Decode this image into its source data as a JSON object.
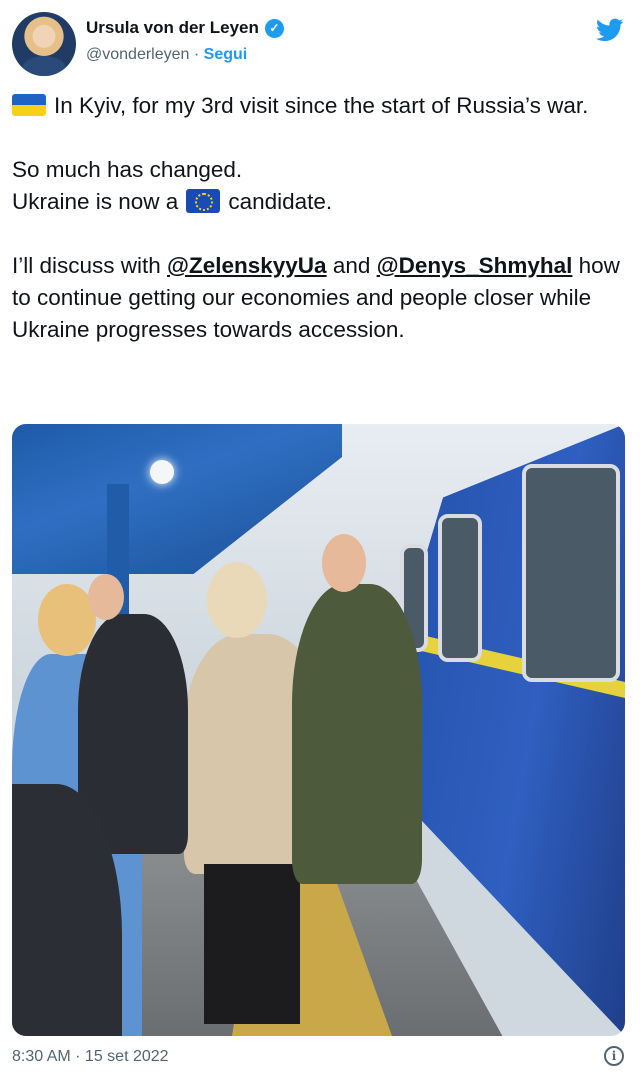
{
  "author": {
    "name": "Ursula von der Leyen",
    "handle": "@vonderleyen",
    "separator": " · ",
    "follow_label": "Segui"
  },
  "tweet": {
    "line1": "In Kyiv, for my 3rd visit since the start of Russia’s war.",
    "line2": "So much has changed.",
    "line3_before": "Ukraine is now a",
    "line3_after": "candidate.",
    "line4_before": "I’ll discuss with ",
    "mention1": "@ZelenskyyUa",
    "line4_mid": " and ",
    "mention2": "@Denys_Shmyhal",
    "line4_after": " how to continue getting our economies and people closer while Ukraine progresses towards accession."
  },
  "footer": {
    "timestamp": "8:30 AM · 15 set 2022"
  },
  "icons": {
    "verified": "verified-badge-icon",
    "bird": "twitter-bird-icon",
    "info": "info-icon",
    "flag1": "ukraine-flag-emoji",
    "flag2": "eu-flag-emoji"
  },
  "colors": {
    "accent": "#1d9bf0",
    "text": "#0f1419",
    "muted": "#536471"
  }
}
